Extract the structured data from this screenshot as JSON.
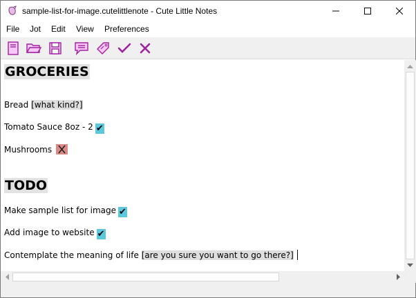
{
  "window": {
    "title": "sample-list-for-image.cutelittlenote - Cute Little Notes"
  },
  "menu": {
    "items": [
      "File",
      "Jot",
      "Edit",
      "View",
      "Preferences"
    ]
  },
  "toolbar": {
    "buttons": [
      "new-note-icon",
      "open-folder-icon",
      "save-disk-icon",
      "comment-bubble-icon",
      "tag-icon",
      "checkmark-icon",
      "cross-icon"
    ]
  },
  "document": {
    "heading1": "GROCERIES",
    "item1_text": "Bread ",
    "item1_note": "[what kind?]",
    "item2_text": "Tomato Sauce 8oz - 2",
    "item3_text": "Mushrooms",
    "heading2": "TODO",
    "item4_text": "Make sample list for image",
    "item5_text": "Add image to website",
    "item6_text": "Contemplate the meaning of life ",
    "item6_note": "[are you sure you want to go there?]",
    "check_glyph": "✔"
  },
  "colors": {
    "check_bg": "#5bc8dc",
    "cross_bg": "#d98a85",
    "heading_bg": "#e2e2e2",
    "note_bg": "#dedede",
    "icon_stroke": "#a020a0",
    "icon_fill": "#f7c8f7"
  }
}
